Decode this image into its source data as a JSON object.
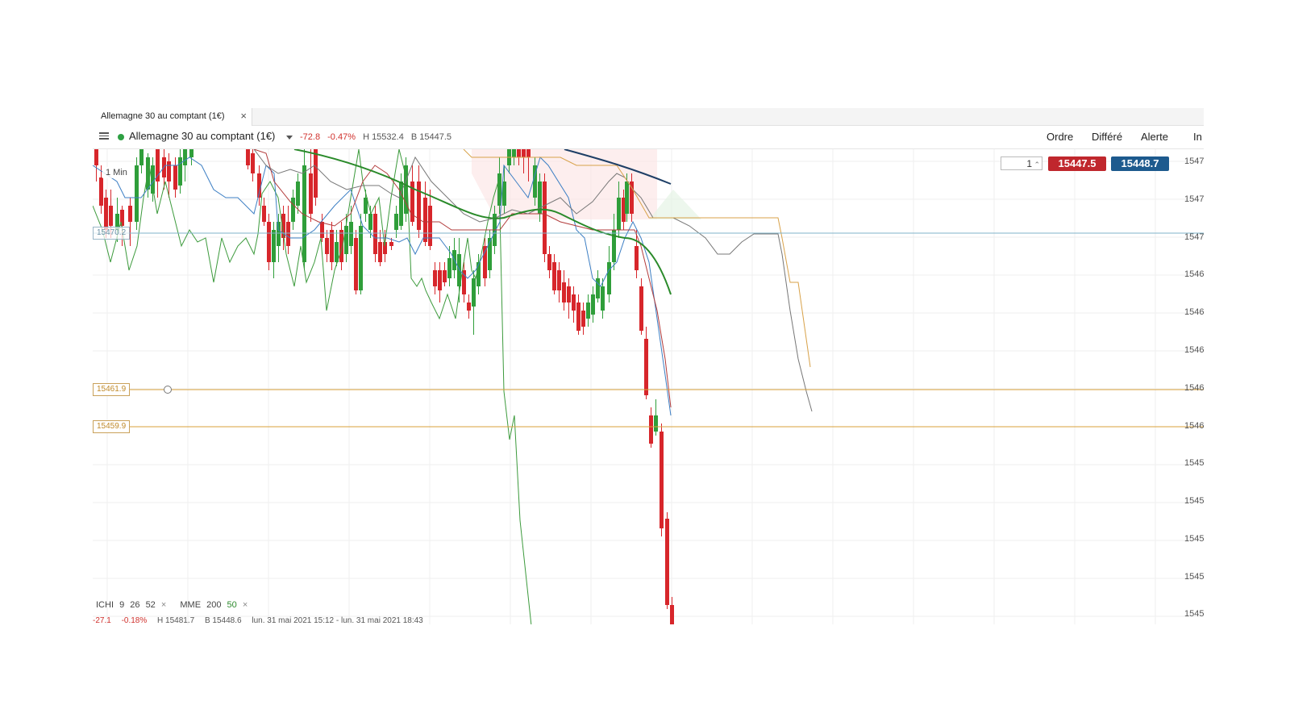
{
  "tab": {
    "title": "Allemagne 30 au comptant (1€)",
    "close": "×"
  },
  "toolbar": {
    "instrument": "Allemagne 30 au comptant (1€)",
    "change": "-72.8",
    "change_pct": "-0.47%",
    "high": "H 15532.4",
    "bid": "B 15447.5",
    "menu": {
      "order": "Ordre",
      "deferred": "Différé",
      "alert": "Alerte",
      "more": "In"
    }
  },
  "chart": {
    "timeframe": "1 Min",
    "quantity": "1",
    "sell_price": "15447.5",
    "buy_price": "15448.7",
    "price_lines": [
      {
        "label": "15470.2",
        "color": "#7fb3c8"
      },
      {
        "label": "15461.9",
        "color": "#d9a23b"
      },
      {
        "label": "15459.9",
        "color": "#d9a23b"
      }
    ],
    "y_axis_labels": [
      "1547",
      "1547",
      "1547",
      "1546",
      "1546",
      "1546",
      "1546",
      "1546",
      "1545",
      "1545",
      "1545",
      "1545",
      "1545"
    ],
    "legend": {
      "ichi": "ICHI",
      "ichi_params": [
        "9",
        "26",
        "52"
      ],
      "mme": "MME",
      "mme_params": [
        "200",
        "50"
      ],
      "close": "×"
    },
    "info": {
      "change": "-27.1",
      "change_pct": "-0.18%",
      "high": "H 15481.7",
      "bid": "B 15448.6",
      "range": "lun. 31 mai 2021 15:12 - lun. 31 mai 2021 18:43"
    },
    "colors": {
      "up": "#2f9e3a",
      "down": "#d7262b",
      "tenkan": "#3d7fc4",
      "kijun": "#b23b3b",
      "chikou": "#3c9a3c",
      "spanA": "#777777",
      "spanB": "#d8a24a",
      "mme200": "#1e3f66",
      "mme50": "#2a8a2a"
    }
  }
}
